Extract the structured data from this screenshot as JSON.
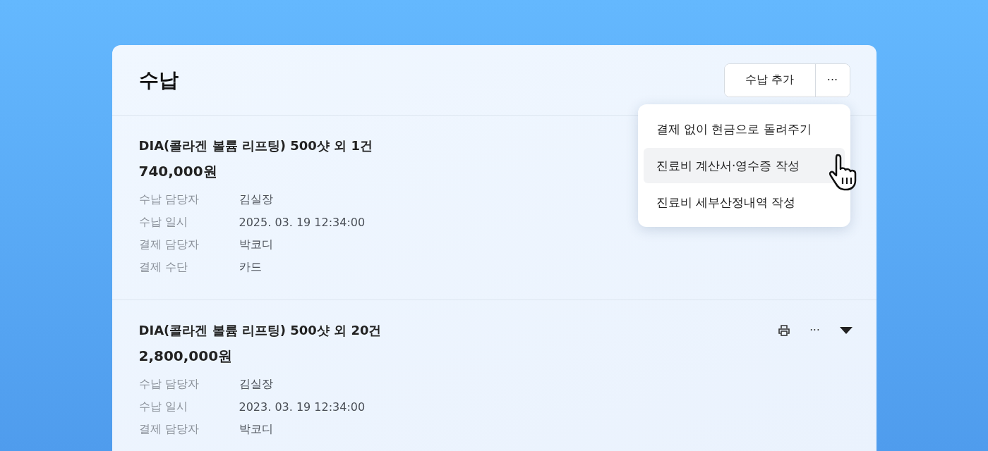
{
  "panel": {
    "title": "수납",
    "add_button": "수납 추가",
    "more_button": "···"
  },
  "menu": [
    {
      "label": "결제 없이 현금으로 돌려주기",
      "selected": false
    },
    {
      "label": "진료비 계산서·영수증 작성",
      "selected": true
    },
    {
      "label": "진료비 세부산정내역 작성",
      "selected": false
    }
  ],
  "payments": [
    {
      "title": "DIA(콜라겐 볼륨 리프팅) 500샷 외 1건",
      "amount": "740,000원",
      "details": [
        {
          "label": "수납 담당자",
          "value": "김실장"
        },
        {
          "label": "수납 일시",
          "value": "2025. 03. 19 12:34:00"
        },
        {
          "label": "결제 담당자",
          "value": "박코디"
        },
        {
          "label": "결제 수단",
          "value": "카드"
        }
      ]
    },
    {
      "title": "DIA(콜라겐 볼륨 리프팅) 500샷 외 20건",
      "amount": "2,800,000원",
      "more": "···",
      "details": [
        {
          "label": "수납 담당자",
          "value": "김실장"
        },
        {
          "label": "수납 일시",
          "value": "2023. 03. 19 12:34:00"
        },
        {
          "label": "결제 담당자",
          "value": "박코디"
        }
      ]
    }
  ]
}
